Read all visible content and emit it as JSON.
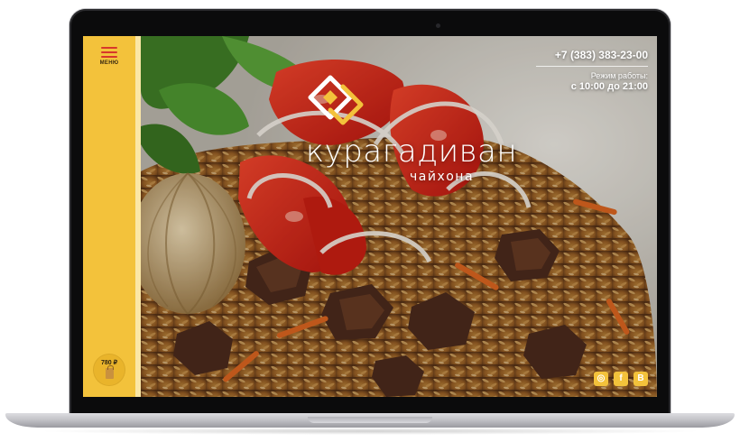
{
  "sidebar": {
    "menu_label": "МЕНЮ",
    "cart_price": "780 ₽"
  },
  "brand": {
    "name": "курагадиван",
    "subtitle": "чайхона"
  },
  "contacts": {
    "phone": "+7 (383) 383-23-00",
    "hours_label": "Режим работы:",
    "hours_value": "с 10:00 до 21:00"
  },
  "social": [
    {
      "icon": "instagram-icon",
      "glyph": "◎"
    },
    {
      "icon": "facebook-icon",
      "glyph": "f"
    },
    {
      "icon": "vk-icon",
      "glyph": "В"
    }
  ],
  "colors": {
    "accent_yellow": "#f3c23b",
    "menu_red": "#d7372b"
  }
}
